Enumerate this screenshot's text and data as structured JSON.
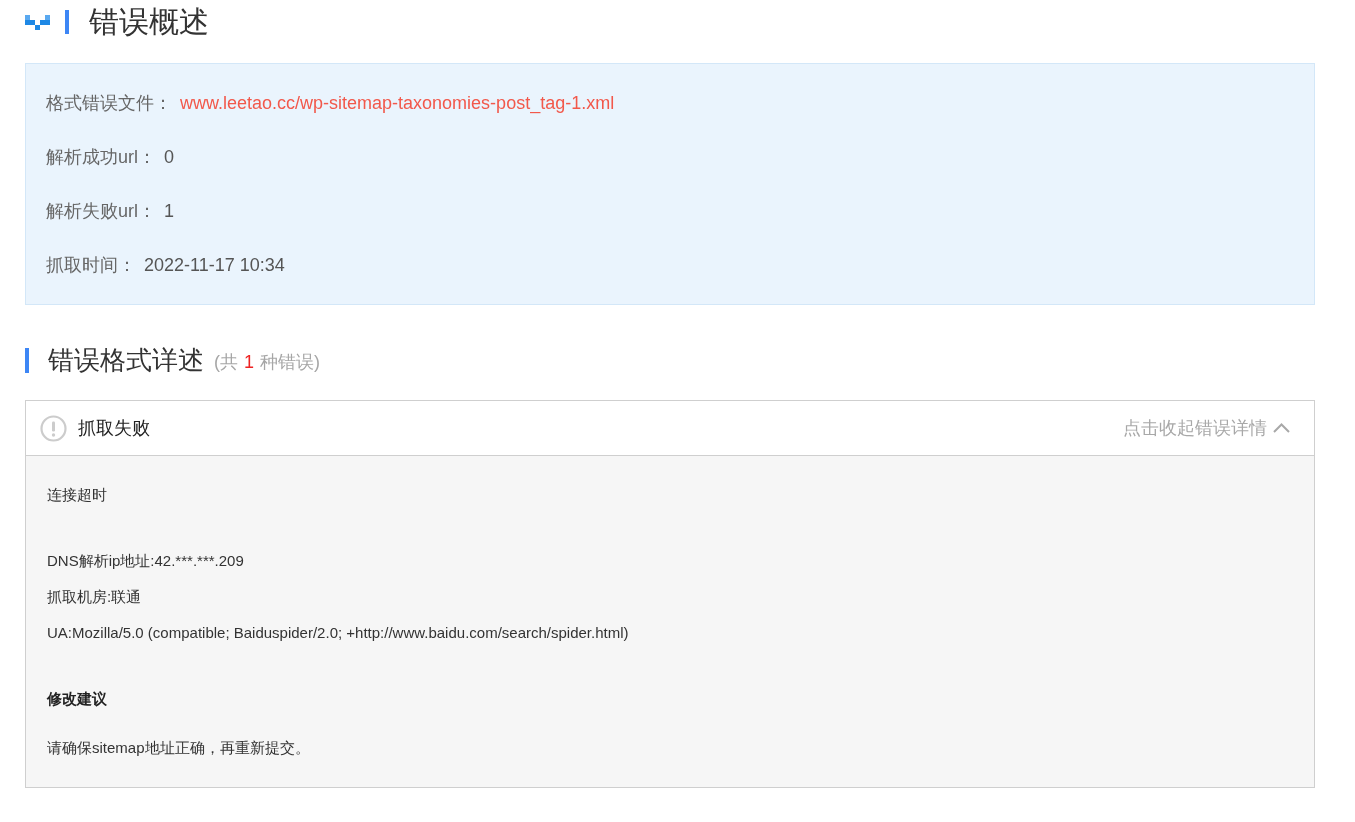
{
  "overview": {
    "title": "错误概述",
    "rows": [
      {
        "label": "格式错误文件：",
        "value": "www.leetao.cc/wp-sitemap-taxonomies-post_tag-1.xml",
        "kind": "link"
      },
      {
        "label": "解析成功url：",
        "value": "0",
        "kind": "text"
      },
      {
        "label": "解析失败url：",
        "value": "1",
        "kind": "text"
      },
      {
        "label": "抓取时间：",
        "value": "2022-11-17 10:34",
        "kind": "text"
      }
    ]
  },
  "details": {
    "title": "错误格式详述",
    "count_prefix": "(共",
    "count": "1",
    "count_suffix": "种错误)",
    "errors": [
      {
        "title": "抓取失败",
        "toggle": "点击收起错误详情",
        "expanded": true,
        "reason": "连接超时",
        "facts": [
          "DNS解析ip地址:42.***.***.209",
          "抓取机房:联通",
          "UA:Mozilla/5.0 (compatible; Baiduspider/2.0; +http://www.baidu.com/search/spider.html)"
        ],
        "advice_title": "修改建议",
        "advice": "请确保sitemap地址正确，再重新提交。"
      }
    ]
  }
}
